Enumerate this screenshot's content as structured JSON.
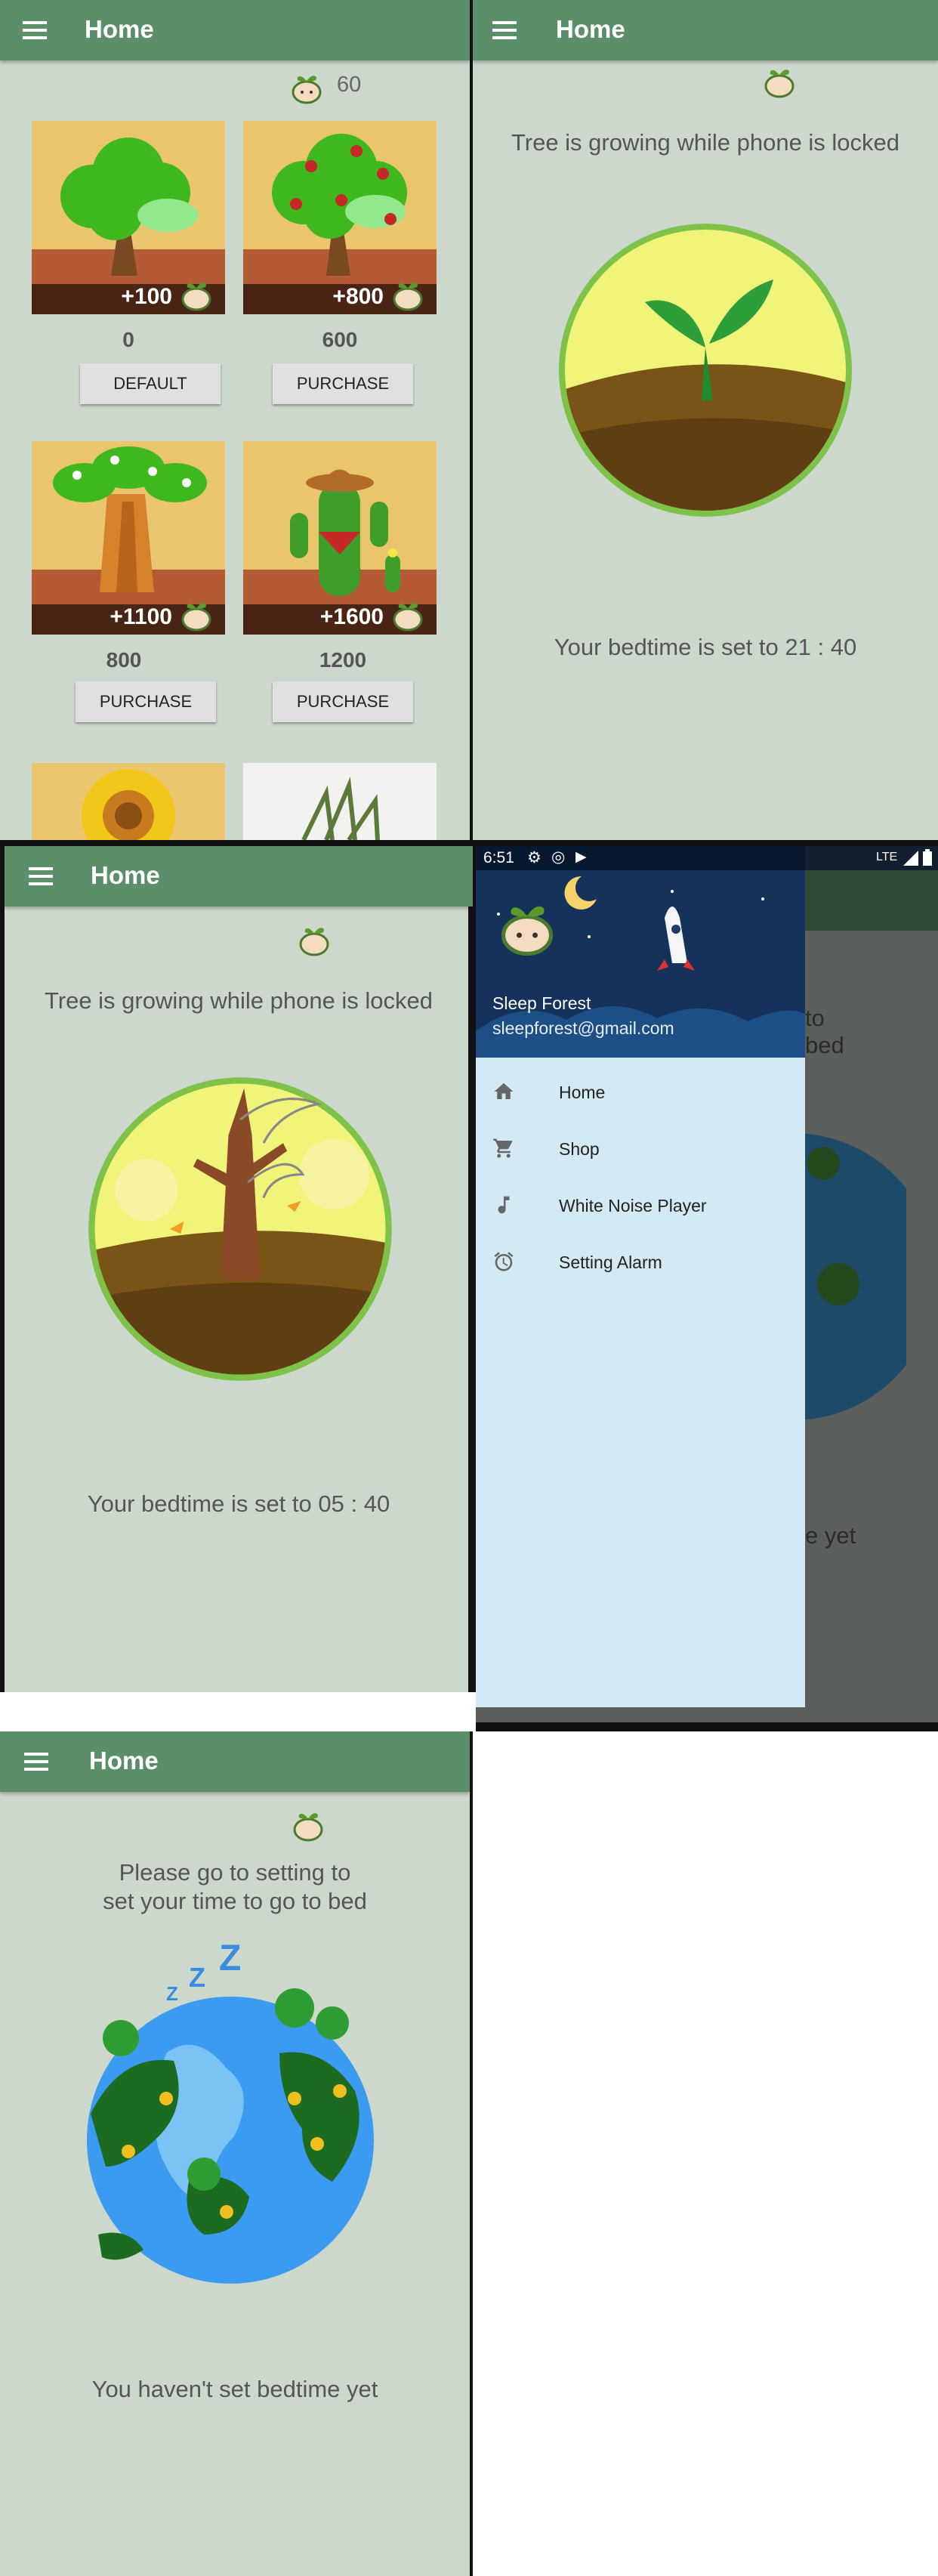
{
  "app": {
    "title": "Home"
  },
  "shop": {
    "coins": "60",
    "items": [
      {
        "bonus": "+100",
        "price": "0",
        "button": "DEFAULT"
      },
      {
        "bonus": "+800",
        "price": "600",
        "button": "PURCHASE"
      },
      {
        "bonus": "+1100",
        "price": "800",
        "button": "PURCHASE"
      },
      {
        "bonus": "+1600",
        "price": "1200",
        "button": "PURCHASE"
      }
    ]
  },
  "growing1": {
    "message": "Tree is growing while phone is locked",
    "bedtime": "Your bedtime is set to 21 : 40"
  },
  "growing2": {
    "message": "Tree is growing while phone is locked",
    "bedtime": "Your bedtime is set to 05 : 40"
  },
  "drawer": {
    "status_time": "6:51",
    "network": "LTE",
    "user_name": "Sleep Forest",
    "user_email": "sleepforest@gmail.com",
    "items": [
      {
        "label": "Home",
        "icon": "home-icon"
      },
      {
        "label": "Shop",
        "icon": "cart-icon"
      },
      {
        "label": "White Noise Player",
        "icon": "music-note-icon"
      },
      {
        "label": "Setting Alarm",
        "icon": "alarm-icon"
      }
    ],
    "bg_text": [
      "to",
      "bed",
      "e yet"
    ]
  },
  "not_set": {
    "message_line1": "Please go to setting to",
    "message_line2": "set your time to go to bed",
    "status": "You haven't set bedtime yet"
  },
  "colors": {
    "appbar": "#5b8f6a",
    "background": "#cdd8cc",
    "drawer": "#d3e9f3",
    "header": "#15325a"
  }
}
